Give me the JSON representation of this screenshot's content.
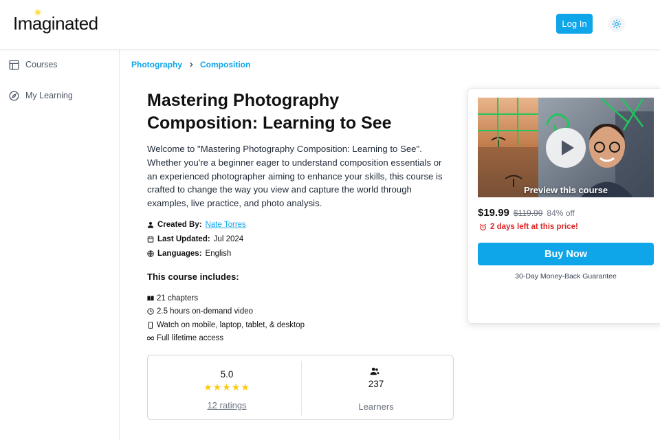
{
  "header": {
    "logo_text": "Imaginated",
    "login_label": "Log In",
    "theme_icon": "sun-icon",
    "accent_color": "#0ea5e9"
  },
  "sidebar": {
    "items": [
      {
        "label": "Courses",
        "icon": "layout-icon"
      },
      {
        "label": "My Learning",
        "icon": "compass-icon"
      }
    ]
  },
  "breadcrumb": {
    "items": [
      "Photography",
      "Composition"
    ]
  },
  "course": {
    "title": "Mastering Photography Composition: Learning to See",
    "description": "Welcome to \"Mastering Photography Composition: Learning to See\". Whether you're a beginner eager to understand composition essentials or an experienced photographer aiming to enhance your skills, this course is crafted to change the way you view and capture the world through examples, live practice, and photo analysis.",
    "created_by_label": "Created By:",
    "created_by": "Nate Torres",
    "last_updated_label": "Last Updated:",
    "last_updated": "Jul 2024",
    "languages_label": "Languages:",
    "languages": "English",
    "includes_title": "This course includes:",
    "includes": [
      {
        "text": "21 chapters",
        "icon": "book-icon"
      },
      {
        "text": "2.5 hours on-demand video",
        "icon": "clock-icon"
      },
      {
        "text": "Watch on mobile, laptop, tablet, & desktop",
        "icon": "mobile-icon"
      },
      {
        "text": "Full lifetime access",
        "icon": "infinity-icon"
      }
    ]
  },
  "stats": {
    "rating": "5.0",
    "stars": "★★★★★",
    "star_count": 5,
    "ratings_link": "12 ratings",
    "learners_count": "237",
    "learners_label": "Learners"
  },
  "purchase": {
    "preview_label": "Preview this course",
    "price": "$19.99",
    "old_price": "$119.99",
    "discount": "84% off",
    "deadline": "2 days left at this price!",
    "buy_label": "Buy Now",
    "guarantee": "30-Day Money-Back Guarantee",
    "deadline_color": "#dc2626"
  }
}
